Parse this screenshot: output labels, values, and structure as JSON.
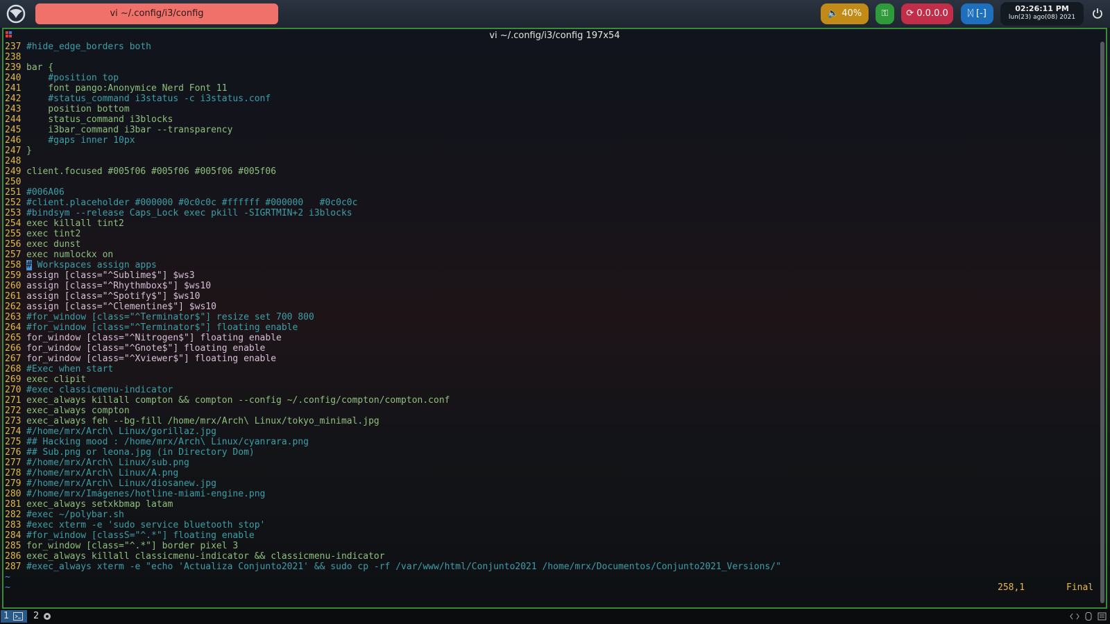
{
  "topbar": {
    "window_title": "vi ~/.config/i3/config",
    "volume": "40%",
    "network": "0.0.0.0",
    "bluetooth": "[-]",
    "clock_time": "02:26:11 PM",
    "clock_date": "lun(23) ago(08) 2021",
    "colors": {
      "title": "#f0706a",
      "volume": "#c28a16",
      "key": "#2e9a3a",
      "network": "#c22e4a",
      "bluetooth": "#1f6fbf"
    }
  },
  "terminal": {
    "title": "vi ~/.config/i3/config 197x54",
    "ruler": "258,1",
    "position": "Final"
  },
  "editor_lines": [
    {
      "n": "237",
      "t": "#hide_edge_borders both",
      "c": "cm"
    },
    {
      "n": "238",
      "t": "",
      "c": ""
    },
    {
      "n": "239",
      "t": "bar {",
      "c": ""
    },
    {
      "n": "240",
      "t": "    #position top",
      "c": "cm"
    },
    {
      "n": "241",
      "t": "    font pango:Anonymice Nerd Font 11",
      "c": ""
    },
    {
      "n": "242",
      "t": "    #status_command i3status -c i3status.conf",
      "c": "cm"
    },
    {
      "n": "243",
      "t": "    position bottom",
      "c": ""
    },
    {
      "n": "244",
      "t": "    status_command i3blocks",
      "c": ""
    },
    {
      "n": "245",
      "t": "    i3bar_command i3bar --transparency",
      "c": ""
    },
    {
      "n": "246",
      "t": "    #gaps inner 10px",
      "c": "cm"
    },
    {
      "n": "247",
      "t": "}",
      "c": ""
    },
    {
      "n": "248",
      "t": "",
      "c": ""
    },
    {
      "n": "249",
      "t": "client.focused #005f06 #005f06 #005f06 #005f06",
      "c": ""
    },
    {
      "n": "250",
      "t": "",
      "c": ""
    },
    {
      "n": "251",
      "t": "#006A06",
      "c": "cm"
    },
    {
      "n": "252",
      "t": "#client.placeholder #000000 #0c0c0c #ffffff #000000   #0c0c0c",
      "c": "cm"
    },
    {
      "n": "253",
      "t": "#bindsym --release Caps_Lock exec pkill -SIGRTMIN+2 i3blocks",
      "c": "cm"
    },
    {
      "n": "254",
      "t": "exec killall tint2",
      "c": ""
    },
    {
      "n": "255",
      "t": "exec tint2",
      "c": ""
    },
    {
      "n": "256",
      "t": "exec dunst",
      "c": ""
    },
    {
      "n": "257",
      "t": "exec numlockx on",
      "c": ""
    },
    {
      "n": "258",
      "t": "# Workspaces assign apps",
      "c": "cur"
    },
    {
      "n": "259",
      "t": "assign [class=\"^Sublime$\"] $ws3",
      "c": "hl"
    },
    {
      "n": "260",
      "t": "assign [class=\"^Rhythmbox$\"] $ws10",
      "c": "hl"
    },
    {
      "n": "261",
      "t": "assign [class=\"^Spotify$\"] $ws10",
      "c": "hl"
    },
    {
      "n": "262",
      "t": "assign [class=\"^Clementine$\"] $ws10",
      "c": "hl"
    },
    {
      "n": "263",
      "t": "#for_window [class=\"^Terminator$\"] resize set 700 800",
      "c": "cm"
    },
    {
      "n": "264",
      "t": "#for_window [class=\"^Terminator$\"] floating enable",
      "c": "cm"
    },
    {
      "n": "265",
      "t": "for_window [class=\"^Nitrogen$\"] floating enable",
      "c": "hl"
    },
    {
      "n": "266",
      "t": "for_window [class=\"^Gnote$\"] floating enable",
      "c": "hl"
    },
    {
      "n": "267",
      "t": "for_window [class=\"^Xviewer$\"] floating enable",
      "c": "hl"
    },
    {
      "n": "268",
      "t": "#Exec when start",
      "c": "cm"
    },
    {
      "n": "269",
      "t": "exec clipit",
      "c": ""
    },
    {
      "n": "270",
      "t": "#exec classicmenu-indicator",
      "c": "cm"
    },
    {
      "n": "271",
      "t": "exec_always killall compton && compton --config ~/.config/compton/compton.conf",
      "c": ""
    },
    {
      "n": "272",
      "t": "exec_always compton",
      "c": ""
    },
    {
      "n": "273",
      "t": "exec_always feh --bg-fill /home/mrx/Arch\\ Linux/tokyo_minimal.jpg",
      "c": ""
    },
    {
      "n": "274",
      "t": "#/home/mrx/Arch\\ Linux/gorillaz.jpg",
      "c": "cm"
    },
    {
      "n": "275",
      "t": "## Hacking mood : /home/mrx/Arch\\ Linux/cyanrara.png",
      "c": "cm"
    },
    {
      "n": "276",
      "t": "## Sub.png or leona.jpg (in Directory Dom)",
      "c": "cm"
    },
    {
      "n": "277",
      "t": "#/home/mrx/Arch\\ Linux/sub.png",
      "c": "cm"
    },
    {
      "n": "278",
      "t": "#/home/mrx/Arch\\ Linux/A.png",
      "c": "cm"
    },
    {
      "n": "279",
      "t": "#/home/mrx/Arch\\ Linux/diosanew.jpg",
      "c": "cm"
    },
    {
      "n": "280",
      "t": "#/home/mrx/Imágenes/hotline-miami-engine.png",
      "c": "cm"
    },
    {
      "n": "281",
      "t": "exec_always setxkbmap latam",
      "c": ""
    },
    {
      "n": "282",
      "t": "#exec ~/polybar.sh",
      "c": "cm"
    },
    {
      "n": "283",
      "t": "#exec xterm -e 'sudo service bluetooth stop'",
      "c": "cm"
    },
    {
      "n": "284",
      "t": "#for_window [classS=\"^.*\"] floating enable",
      "c": "cm"
    },
    {
      "n": "285",
      "t": "for_window [class=\"^.*\"] border pixel 3",
      "c": ""
    },
    {
      "n": "286",
      "t": "exec_always killall classicmenu-indicator && classicmenu-indicator",
      "c": ""
    },
    {
      "n": "287",
      "t": "#exec_always xterm -e \"echo 'Actualiza Conjunto2021' && sudo cp -rf /var/www/html/Conjunto2021 /home/mrx/Documentos/Conjunto2021_Versions/\"",
      "c": "cm"
    }
  ],
  "empty_marker": "~",
  "workspaces": [
    {
      "num": "1",
      "icon": "terminal-icon"
    },
    {
      "num": "2",
      "icon": "app-icon"
    }
  ]
}
